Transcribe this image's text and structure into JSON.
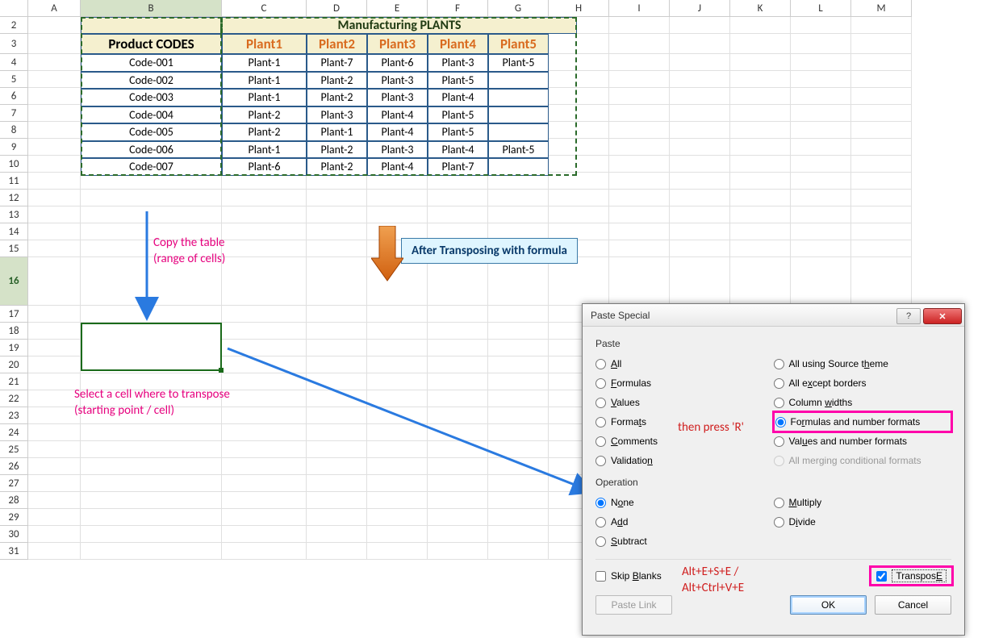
{
  "columns": [
    "A",
    "B",
    "C",
    "D",
    "E",
    "F",
    "G",
    "H",
    "I",
    "J",
    "K",
    "L",
    "M"
  ],
  "rows_visible": [
    2,
    3,
    4,
    5,
    6,
    7,
    8,
    9,
    10,
    11,
    12,
    13,
    14,
    15,
    16,
    17,
    18,
    19,
    20,
    21,
    22,
    23,
    24,
    25,
    26,
    27,
    28,
    29,
    30,
    31
  ],
  "selected_col": "B",
  "selected_row": 16,
  "table": {
    "title_left": "",
    "title_right": "Manufacturing PLANTS",
    "header_first": "Product CODES",
    "headers": [
      "Plant1",
      "Plant2",
      "Plant3",
      "Plant4",
      "Plant5"
    ],
    "rows": [
      {
        "code": "Code-001",
        "vals": [
          "Plant-1",
          "Plant-7",
          "Plant-6",
          "Plant-3",
          "Plant-5"
        ]
      },
      {
        "code": "Code-002",
        "vals": [
          "Plant-1",
          "Plant-2",
          "Plant-3",
          "Plant-5",
          ""
        ]
      },
      {
        "code": "Code-003",
        "vals": [
          "Plant-1",
          "Plant-2",
          "Plant-3",
          "Plant-4",
          ""
        ]
      },
      {
        "code": "Code-004",
        "vals": [
          "Plant-2",
          "Plant-3",
          "Plant-4",
          "Plant-5",
          ""
        ]
      },
      {
        "code": "Code-005",
        "vals": [
          "Plant-2",
          "Plant-1",
          "Plant-4",
          "Plant-5",
          ""
        ]
      },
      {
        "code": "Code-006",
        "vals": [
          "Plant-1",
          "Plant-2",
          "Plant-3",
          "Plant-4",
          "Plant-5"
        ]
      },
      {
        "code": "Code-007",
        "vals": [
          "Plant-6",
          "Plant-2",
          "Plant-4",
          "Plant-7",
          ""
        ]
      }
    ]
  },
  "annotations": {
    "copy1": "Copy the table",
    "copy2": "(range of cells)",
    "sel1": "Select a cell where to transpose",
    "sel2": "(starting point / cell)",
    "callout": "After Transposing with formula",
    "thenR": "then press 'R'",
    "shortcut1": "Alt+E+S+E   /",
    "shortcut2": "Alt+Ctrl+V+E"
  },
  "dialog": {
    "title": "Paste Special",
    "help_icon": "?",
    "close_icon": "✕",
    "grp_paste": "Paste",
    "grp_op": "Operation",
    "paste_left": [
      {
        "label": "All",
        "u": "A",
        "checked": false
      },
      {
        "label": "Formulas",
        "u": "F",
        "checked": false
      },
      {
        "label": "Values",
        "u": "V",
        "checked": false
      },
      {
        "label": "Formats",
        "u": "T",
        "checked": false
      },
      {
        "label": "Comments",
        "u": "C",
        "checked": false
      },
      {
        "label": "Validation",
        "u": "N",
        "checked": false
      }
    ],
    "paste_right": [
      {
        "label": "All using Source theme",
        "u": "H",
        "checked": false,
        "disabled": false
      },
      {
        "label": "All except borders",
        "u": "X",
        "checked": false,
        "disabled": false
      },
      {
        "label": "Column widths",
        "u": "W",
        "checked": false,
        "disabled": false
      },
      {
        "label": "Formulas and number formats",
        "u": "R",
        "checked": true,
        "disabled": false,
        "highlight": true
      },
      {
        "label": "Values and number formats",
        "u": "U",
        "checked": false,
        "disabled": false
      },
      {
        "label": "All merging conditional formats",
        "u": "G",
        "checked": false,
        "disabled": true
      }
    ],
    "op_left": [
      {
        "label": "None",
        "u": "O",
        "checked": true
      },
      {
        "label": "Add",
        "u": "D",
        "checked": false
      },
      {
        "label": "Subtract",
        "u": "S",
        "checked": false
      }
    ],
    "op_right": [
      {
        "label": "Multiply",
        "u": "M",
        "checked": false
      },
      {
        "label": "Divide",
        "u": "I",
        "checked": false
      }
    ],
    "skip_blanks": "Skip blanks",
    "skip_u": "B",
    "transpose": "Transpose",
    "transpose_u": "E",
    "transpose_checked": true,
    "btn_pastelink": "Paste Link",
    "btn_ok": "OK",
    "btn_cancel": "Cancel"
  }
}
